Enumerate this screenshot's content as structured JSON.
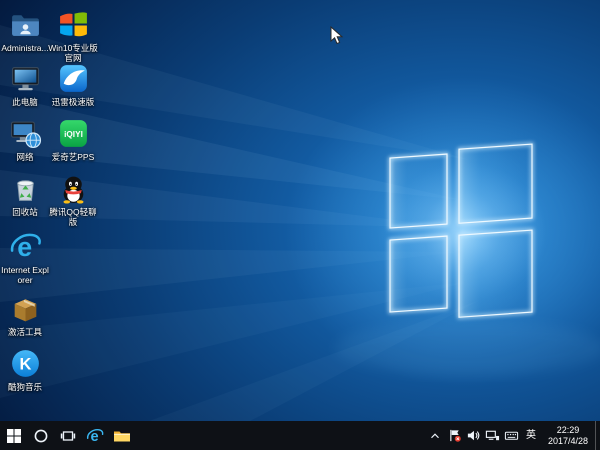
{
  "colors": {
    "wallpaper_blue": "#1673c2",
    "taskbar_bg": "#0e1116",
    "ie_blue": "#2fb0ea",
    "iqiyi_green": "#12c04e",
    "qq_scarf_red": "#e8413c",
    "label_text": "#ffffff"
  },
  "desktop": {
    "icons": {
      "admin": {
        "label": "Administra..."
      },
      "win10": {
        "label": "Win10专业版官网"
      },
      "thispc": {
        "label": "此电脑"
      },
      "thunder": {
        "label": "迅雷极速版"
      },
      "network": {
        "label": "网络"
      },
      "iqiyi": {
        "label": "爱奇艺PPS",
        "icon_text": "iQIYI"
      },
      "recycle": {
        "label": "回收站"
      },
      "qq": {
        "label": "腾讯QQ轻聊版"
      },
      "ie": {
        "label": "Internet Explorer",
        "icon_text": "e"
      },
      "activate": {
        "label": "激活工具"
      },
      "kugou": {
        "label": "酷狗音乐",
        "icon_text": "K"
      }
    }
  },
  "taskbar": {
    "tray": {
      "ime": "英",
      "time": "22:29",
      "date": "2017/4/28"
    }
  }
}
